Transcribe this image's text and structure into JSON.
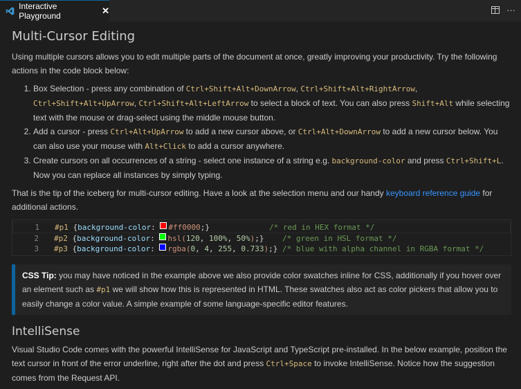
{
  "tab": {
    "title": "Interactive Playground",
    "close": "✕",
    "more": "···"
  },
  "section1": {
    "heading": "Multi-Cursor Editing",
    "intro": "Using multiple cursors allows you to edit multiple parts of the document at once, greatly improving your productivity. Try the following actions in the code block below:",
    "items": [
      {
        "p1": "Box Selection - press any combination of ",
        "k1": "Ctrl+Shift+Alt+DownArrow",
        "s1": ", ",
        "k2": "Ctrl+Shift+Alt+RightArrow",
        "s2": ", ",
        "k3": "Ctrl+Shift+Alt+UpArrow",
        "s3": ", ",
        "k4": "Ctrl+Shift+Alt+LeftArrow",
        "p2": " to select a block of text. You can also press ",
        "k5": "Shift+Alt",
        "p3": " while selecting text with the mouse or drag-select using the middle mouse button."
      },
      {
        "p1": "Add a cursor - press ",
        "k1": "Ctrl+Alt+UpArrow",
        "p2": " to add a new cursor above, or ",
        "k2": "Ctrl+Alt+DownArrow",
        "p3": " to add a new cursor below. You can also use your mouse with ",
        "k3": "Alt+Click",
        "p4": " to add a cursor anywhere."
      },
      {
        "p1": "Create cursors on all occurrences of a string - select one instance of a string e.g. ",
        "k1": "background-color",
        "p2": " and press ",
        "k2": "Ctrl+Shift+L",
        "p3": ". Now you can replace all instances by simply typing."
      }
    ],
    "outro_before": "That is the tip of the iceberg for multi-cursor editing. Have a look at the selection menu and our handy ",
    "outro_link": "keyboard reference guide",
    "outro_after": " for additional actions."
  },
  "code": {
    "lines": [
      {
        "num": "1",
        "sel": "#p1",
        "open": " {",
        "prop": "background-color",
        "colon": ": ",
        "swatch": "#ff0000",
        "val": "#ff0000",
        "close": ";}",
        "pad": "             ",
        "cmt": "/* red in HEX format */"
      },
      {
        "num": "2",
        "sel": "#p2",
        "open": " {",
        "prop": "background-color",
        "colon": ": ",
        "swatch": "#00ff00",
        "val_fn": "hsl(",
        "n1": "120",
        "c1": ", ",
        "n2": "100%",
        "c2": ", ",
        "n3": "50%",
        "val_end": ")",
        "close": ";}",
        "pad": "    ",
        "cmt": "/* green in HSL format */"
      },
      {
        "num": "3",
        "sel": "#p3",
        "open": " {",
        "prop": "background-color",
        "colon": ": ",
        "swatch": "#0004ff",
        "val_fn": "rgba(",
        "n1": "0",
        "c1": ", ",
        "n2": "4",
        "c2": ", ",
        "n3": "255",
        "c3": ", ",
        "n4": "0.733",
        "val_end": ")",
        "close": ";}",
        "pad": " ",
        "cmt": "/* blue with alpha channel in RGBA format */"
      }
    ]
  },
  "tip": {
    "label": "CSS Tip:",
    "t1": " you may have noticed in the example above we also provide color swatches inline for CSS, additionally if you hover over an element such as ",
    "k1": "#p1",
    "t2": " we will show how this is represented in HTML. These swatches also act as color pickers that allow you to easily change a color value. A simple example of some language-specific editor features."
  },
  "section2": {
    "heading": "IntelliSense",
    "p1": "Visual Studio Code comes with the powerful IntelliSense for JavaScript and TypeScript pre-installed. In the below example, position the text cursor in front of the error underline, right after the dot and press ",
    "k1": "Ctrl+Space",
    "p2": " to invoke IntelliSense. Notice how the suggestion comes from the Request API."
  },
  "colors": {
    "accent": "#0e639c",
    "link": "#3794ff",
    "keybinding": "#d7ba7d"
  }
}
